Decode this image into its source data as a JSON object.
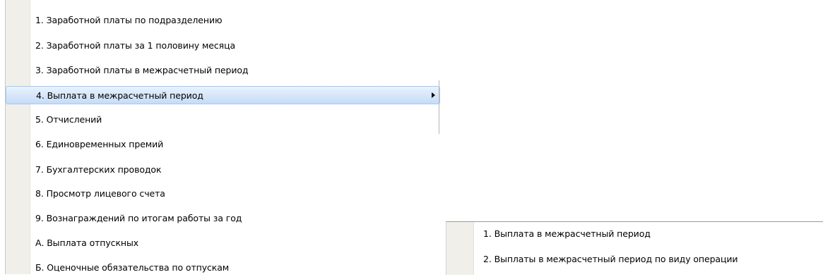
{
  "main_menu": {
    "items": [
      {
        "label": "1. Заработной платы по подразделению"
      },
      {
        "label": "2. Заработной платы за 1 половину месяца"
      },
      {
        "label": "3. Заработной платы в межрасчетный период"
      },
      {
        "label": "4. Выплата в межрасчетный период",
        "highlighted": true,
        "has_submenu": true
      },
      {
        "label": "5. Отчислений"
      },
      {
        "label": "6. Единовременных премий"
      },
      {
        "label": "7. Бухгалтерских проводок"
      },
      {
        "label": "8. Просмотр лицевого счета"
      },
      {
        "label": "9. Вознаграждений по итогам работы за год"
      },
      {
        "label": "А. Выплата отпускных"
      },
      {
        "label": "Б. Оценочные обязательства по отпускам"
      }
    ]
  },
  "submenu": {
    "items": [
      {
        "label": "1. Выплата в межрасчетный период"
      },
      {
        "label": "2. Выплаты в межрасчетный период по виду операции"
      }
    ]
  },
  "colors": {
    "highlight": "#c5dcf8",
    "gutter": "#f0efea"
  }
}
